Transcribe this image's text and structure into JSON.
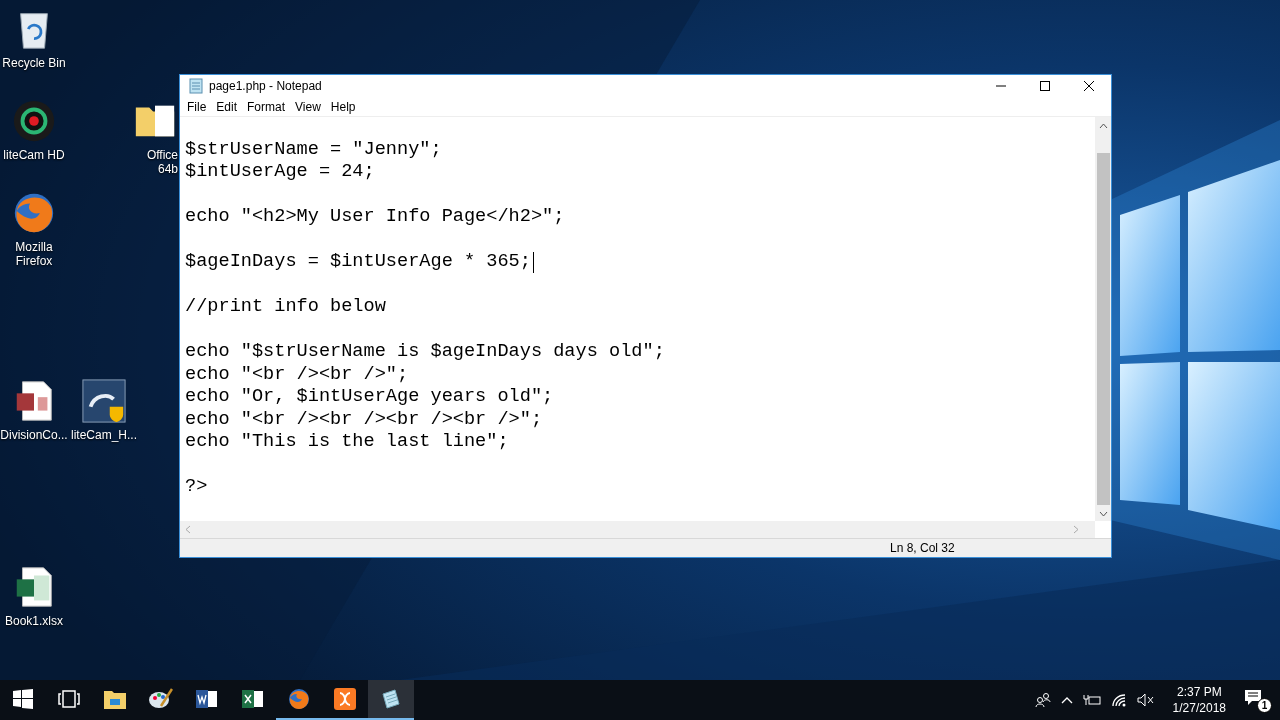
{
  "desktop_icons": [
    {
      "kind": "recycle-bin",
      "label": "Recycle Bin"
    },
    {
      "kind": "webcam",
      "label": "liteCam HD"
    },
    {
      "kind": "firefox",
      "label": "Mozilla Firefox"
    },
    {
      "kind": "folder",
      "label": "Office 64b"
    },
    {
      "kind": "access",
      "label": "DivisionCo..."
    },
    {
      "kind": "installer",
      "label": "liteCam_H..."
    },
    {
      "kind": "excel",
      "label": "Book1.xlsx"
    }
  ],
  "window": {
    "title": "page1.php - Notepad",
    "menu": [
      "File",
      "Edit",
      "Format",
      "View",
      "Help"
    ],
    "blocks": [
      [
        {
          "text": "$strUserName = \"Jenny\";",
          "caret": false
        },
        {
          "text": "$intUserAge = 24;",
          "caret": false
        }
      ],
      [
        {
          "text": "echo \"<h2>My User Info Page</h2>\";",
          "caret": false
        }
      ],
      [
        {
          "text": "$ageInDays = $intUserAge * 365;",
          "caret": true
        }
      ],
      [
        {
          "text": "//print info below",
          "caret": false
        }
      ],
      [
        {
          "text": "echo \"$strUserName is $ageInDays days old\";",
          "caret": false
        },
        {
          "text": "echo \"<br /><br />\";",
          "caret": false
        },
        {
          "text": "echo \"Or, $intUserAge years old\";",
          "caret": false
        },
        {
          "text": "echo \"<br /><br /><br /><br />\";",
          "caret": false
        },
        {
          "text": "echo \"This is the last line\";",
          "caret": false
        }
      ],
      [
        {
          "text": "?>",
          "caret": false
        }
      ]
    ],
    "status": "Ln 8, Col 32"
  },
  "taskbar": {
    "items": [
      {
        "kind": "start",
        "running": false,
        "selected": false
      },
      {
        "kind": "task-view",
        "running": false,
        "selected": false
      },
      {
        "kind": "explorer",
        "running": false,
        "selected": false
      },
      {
        "kind": "paint",
        "running": false,
        "selected": false
      },
      {
        "kind": "word",
        "running": false,
        "selected": false
      },
      {
        "kind": "excel",
        "running": false,
        "selected": false
      },
      {
        "kind": "firefox",
        "running": true,
        "selected": false
      },
      {
        "kind": "xampp",
        "running": true,
        "selected": false
      },
      {
        "kind": "notepad",
        "running": true,
        "selected": true
      }
    ],
    "time": "2:37 PM",
    "date": "1/27/2018",
    "notifications": "1"
  }
}
